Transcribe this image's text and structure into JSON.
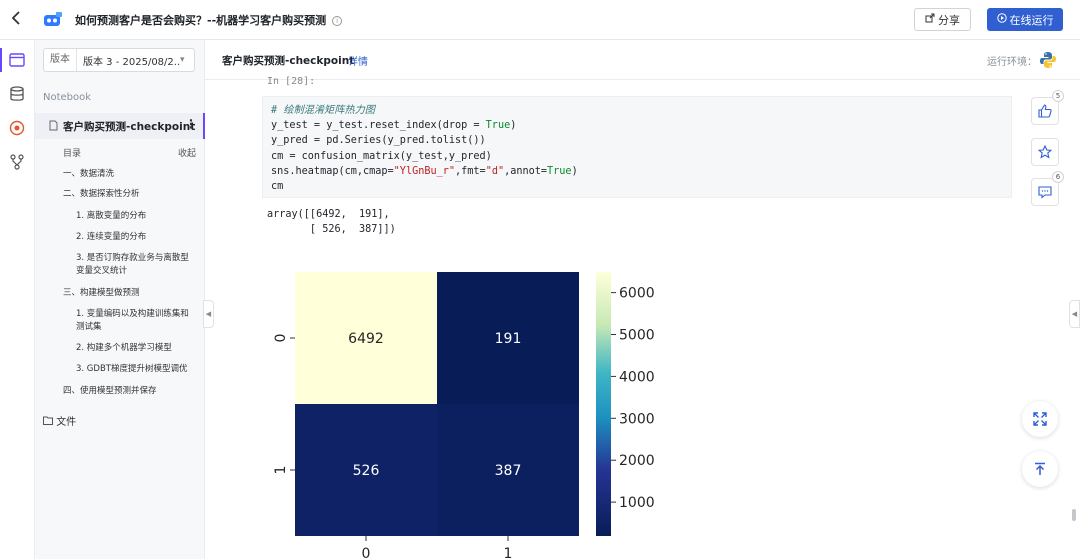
{
  "header": {
    "title": "如何预测客户是否会购买？--机器学习客户购买预测",
    "share_label": "分享",
    "run_label": "在线运行"
  },
  "sidebar": {
    "version_label": "版本",
    "version_value": "版本 3 - 2025/08/2...",
    "notebook_label": "Notebook",
    "notebook_item": "客户购买预测-checkpoint",
    "toc_label": "目录",
    "collapse_label": "收起",
    "toc": [
      "一、数据清洗",
      "二、数据探索性分析",
      "1. 离散变量的分布",
      "2. 连续变量的分布",
      "3. 是否订购存款业务与离散型",
      "变量交叉统计",
      "三、构建模型做预测",
      "1. 变量编码以及构建训练集和",
      "测试集",
      "2. 构建多个机器学习模型",
      "3. GDBT梯度提升树模型调优",
      "四、使用模型预测并保存"
    ],
    "files_label": "文件"
  },
  "main": {
    "checkpoint_name": "客户购买预测-checkpoint",
    "detail_link": "详情",
    "env_label": "运行环境：",
    "prompt": "In [28]:",
    "code_comment": "# 绘制混淆矩阵热力图",
    "output_line1": "array([[6492,  191],",
    "output_line2": "       [ 526,  387]])"
  },
  "float": {
    "like_count": "5",
    "comment_count": "6"
  },
  "colors": {
    "accent": "#2f5fd0",
    "active": "#6b46ff"
  },
  "chart_data": {
    "type": "heatmap",
    "cmap": "YlGnBu_r",
    "x_ticks": [
      "0",
      "1"
    ],
    "y_ticks": [
      "0",
      "1"
    ],
    "matrix": [
      [
        6492,
        191
      ],
      [
        526,
        387
      ]
    ],
    "colorbar_ticks": [
      "6000",
      "5000",
      "4000",
      "3000",
      "2000",
      "1000"
    ],
    "colorbar_range": [
      191,
      6492
    ]
  }
}
